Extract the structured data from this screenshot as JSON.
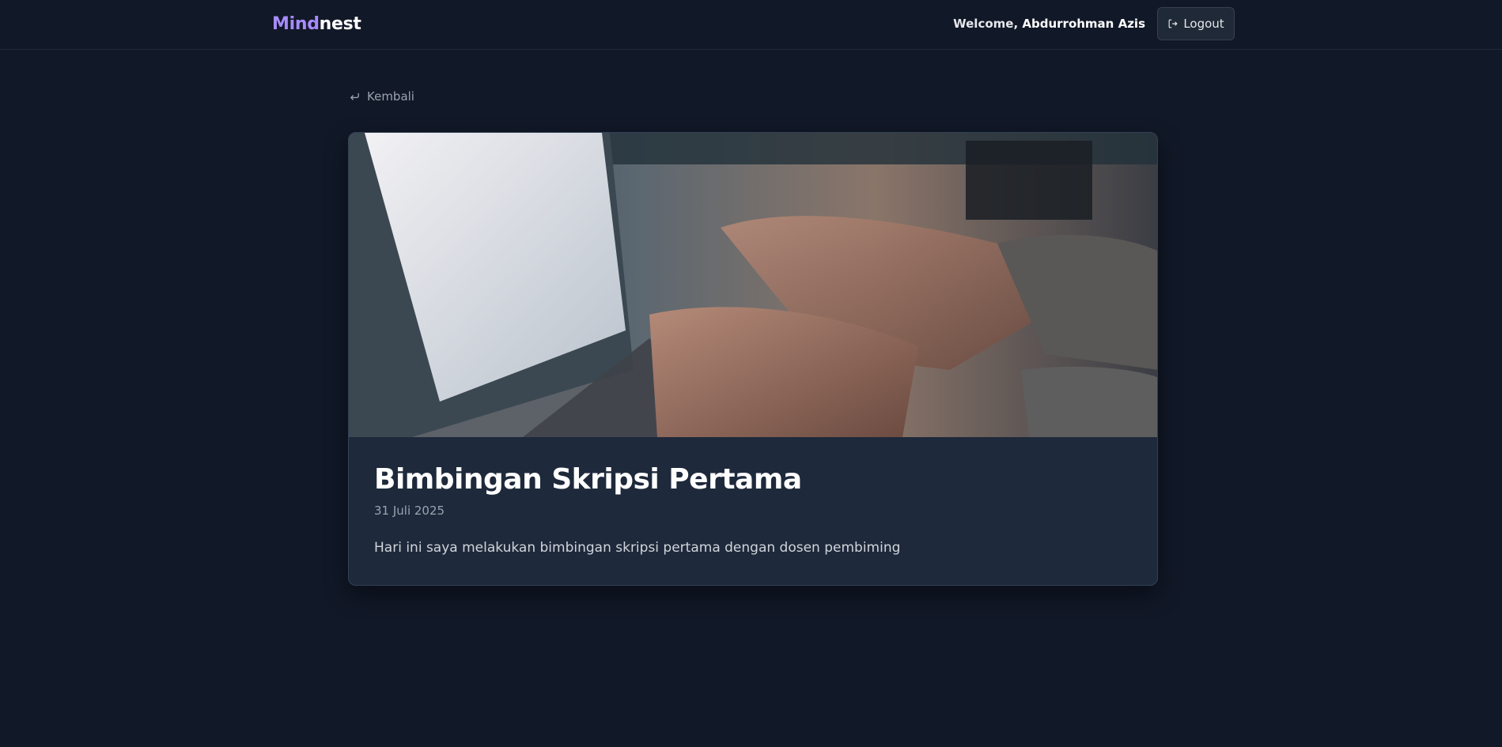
{
  "header": {
    "logo_part1": "Mind",
    "logo_part2": "nest",
    "welcome_label": "Welcome,",
    "user_name": "Abdurrohman Azis",
    "logout_label": "Logout"
  },
  "nav": {
    "back_label": "Kembali"
  },
  "entry": {
    "title": "Bimbingan Skripsi Pertama",
    "date": "31 Juli 2025",
    "content": "Hari ini saya melakukan bimbingan skripsi pertama dengan dosen pembiming"
  },
  "colors": {
    "background": "#111827",
    "card": "#1e293b",
    "accent": "#a78bfa"
  },
  "icons": {
    "logout": "logout-icon",
    "back": "return-arrow-icon"
  }
}
